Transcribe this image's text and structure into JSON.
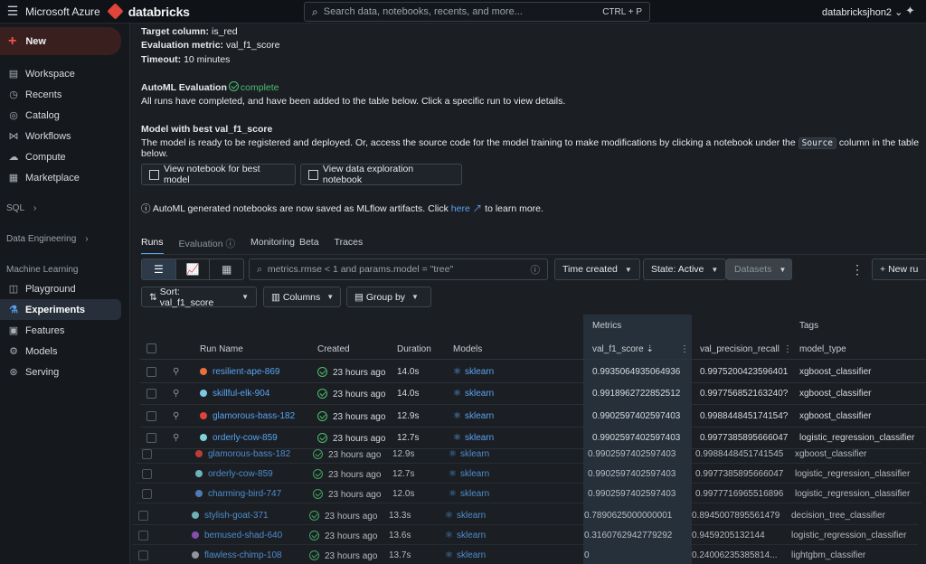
{
  "topbar": {
    "brand": "Microsoft Azure",
    "product": "databricks",
    "search_placeholder": "Search data, notebooks, recents, and more...",
    "shortcut": "CTRL + P",
    "user": "databricksjhon2 ⌄"
  },
  "sidebar": {
    "new_label": "New",
    "items": [
      {
        "label": "Workspace",
        "icon": "folder-icon"
      },
      {
        "label": "Recents",
        "icon": "clock-icon"
      },
      {
        "label": "Catalog",
        "icon": "catalog-icon"
      },
      {
        "label": "Workflows",
        "icon": "workflows-icon"
      },
      {
        "label": "Compute",
        "icon": "cloud-icon"
      },
      {
        "label": "Marketplace",
        "icon": "store-icon"
      }
    ],
    "sql_label": "SQL",
    "data_engineering_label": "Data Engineering",
    "ml_label": "Machine Learning",
    "ml_items": [
      {
        "label": "Playground",
        "icon": "playground-icon",
        "active": false
      },
      {
        "label": "Experiments",
        "icon": "flask-icon",
        "active": true
      },
      {
        "label": "Features",
        "icon": "features-icon",
        "active": false
      },
      {
        "label": "Models",
        "icon": "models-icon",
        "active": false
      },
      {
        "label": "Serving",
        "icon": "serving-icon",
        "active": false
      }
    ]
  },
  "summary": {
    "target_label": "Target column:",
    "target_value": "is_red",
    "metric_label": "Evaluation metric:",
    "metric_value": "val_f1_score",
    "timeout_label": "Timeout:",
    "timeout_value": "10 minutes",
    "automl_title": "AutoML Evaluation",
    "automl_status": "complete",
    "automl_desc": "All runs have completed, and have been added to the table below. Click a specific run to view details.",
    "best_title": "Model with best val_f1_score",
    "best_desc_1": "The model is ready to be registered and deployed. Or, access the source code for the model training to make modifications by clicking a notebook under the",
    "best_desc_code": "Source",
    "best_desc_2": "column in the table below.",
    "btn_best": "View notebook for best model",
    "btn_explore": "View data exploration notebook",
    "note_1": "AutoML generated notebooks are now saved as MLflow artifacts. Click",
    "note_link": "here",
    "note_2": "to learn more."
  },
  "tabs": [
    {
      "label": "Runs",
      "active": true
    },
    {
      "label": "Evaluation",
      "active": false
    },
    {
      "label": "Monitoring",
      "badge": "Beta",
      "active": false
    },
    {
      "label": "Traces",
      "active": false
    }
  ],
  "toolbar": {
    "filter_placeholder": "metrics.rmse < 1 and params.model = \"tree\"",
    "time_created": "Time created",
    "state": "State: Active",
    "datasets": "Datasets",
    "new_run": "New ru",
    "sort": "Sort: val_f1_score",
    "columns": "Columns",
    "group_by": "Group by"
  },
  "table": {
    "group_metrics": "Metrics",
    "group_tags": "Tags",
    "headers": {
      "run_name": "Run Name",
      "created": "Created",
      "duration": "Duration",
      "models": "Models",
      "f1": "val_f1_score",
      "precision": "val_precision_recall",
      "model_type": "model_type"
    },
    "rows": [
      {
        "name": "resilient-ape-869",
        "color": "#e8703a",
        "created": "23 hours ago",
        "duration": "14.0s",
        "model": "sklearn",
        "f1": "0.9935064935064936",
        "precision": "0.9975200423596401",
        "type": "xgboost_classifier"
      },
      {
        "name": "skillful-elk-904",
        "color": "#7ec8e3",
        "created": "23 hours ago",
        "duration": "14.0s",
        "model": "sklearn",
        "f1": "0.9918962722852512",
        "precision": "0.997756852163240?",
        "type": "xgboost_classifier"
      },
      {
        "name": "glamorous-bass-182",
        "color": "#e0443a",
        "created": "23 hours ago",
        "duration": "12.9s",
        "model": "sklearn",
        "f1": "0.9902597402597403",
        "precision": "0.998844845174154?",
        "type": "xgboost_classifier"
      },
      {
        "name": "orderly-cow-859",
        "color": "#7ed3d8",
        "created": "23 hours ago",
        "duration": "12.7s",
        "model": "sklearn",
        "f1": "0.9902597402597403",
        "precision": "0.9977385895666047",
        "type": "logistic_regression_classifier"
      },
      {
        "name": "glamorous-bass-182",
        "color": "#e0443a",
        "created": "23 hours ago",
        "duration": "12.9s",
        "model": "sklearn",
        "f1": "0.9902597402597403",
        "precision": "0.9988448451741545",
        "type": "xgboost_classifier"
      },
      {
        "name": "orderly-cow-859",
        "color": "#7ed3d8",
        "created": "23 hours ago",
        "duration": "12.7s",
        "model": "sklearn",
        "f1": "0.9902597402597403",
        "precision": "0.9977385895666047",
        "type": "logistic_regression_classifier"
      },
      {
        "name": "charming-bird-747",
        "color": "#5a8fd6",
        "created": "23 hours ago",
        "duration": "12.0s",
        "model": "sklearn",
        "f1": "0.9902597402597403",
        "precision": "0.9977716965516896",
        "type": "logistic_regression_classifier"
      },
      {
        "name": "stylish-goat-371",
        "color": "#7ed3d8",
        "created": "23 hours ago",
        "duration": "13.3s",
        "model": "sklearn",
        "f1": "0.7890625000000001",
        "precision": "0.8945007895561479",
        "type": "decision_tree_classifier"
      },
      {
        "name": "bemused-shad-640",
        "color": "#9b59d0",
        "created": "23 hours ago",
        "duration": "13.6s",
        "model": "sklearn",
        "f1": "0.3160762942779292",
        "precision": "0.9459205132144",
        "type": "logistic_regression_classifier"
      },
      {
        "name": "flawless-chimp-108",
        "color": "#aab1b9",
        "created": "23 hours ago",
        "duration": "13.7s",
        "model": "sklearn",
        "f1": "0",
        "precision": "0.24006235385814...",
        "type": "lightgbm_classifier"
      }
    ]
  }
}
